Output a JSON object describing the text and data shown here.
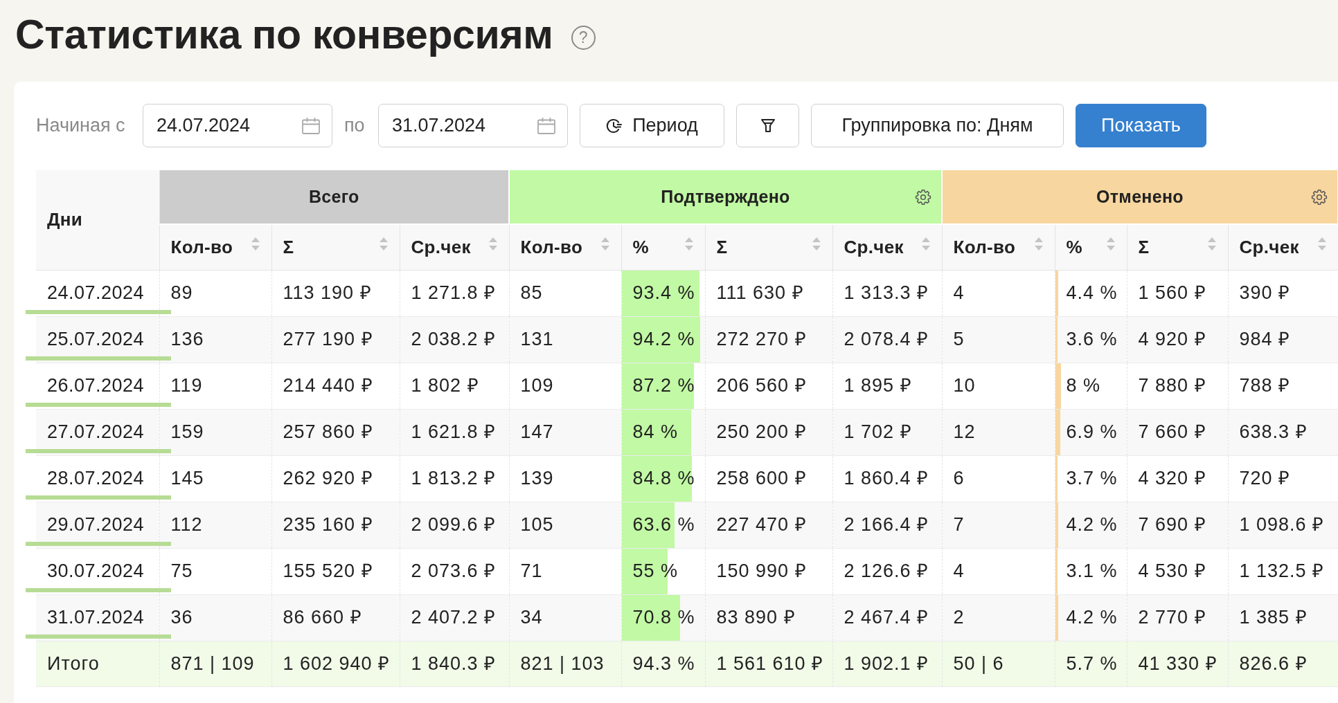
{
  "page": {
    "title": "Статистика по конверсиям",
    "help_icon": "?"
  },
  "toolbar": {
    "from_label": "Начиная с",
    "date_from": "24.07.2024",
    "to_label": "по",
    "date_to": "31.07.2024",
    "period_button": "Период",
    "grouping_button": "Группировка по: Дням",
    "show_button": "Показать"
  },
  "table": {
    "first_column": "Дни",
    "groups": [
      {
        "title": "Всего",
        "color": "#cccccc",
        "settings_icon": false,
        "columns": [
          {
            "label": "Кол-во",
            "kind": "text"
          },
          {
            "label": "Σ",
            "kind": "text"
          },
          {
            "label": "Ср.чек",
            "kind": "text"
          }
        ]
      },
      {
        "title": "Подтверждено",
        "color": "#c1f9a4",
        "settings_icon": true,
        "columns": [
          {
            "label": "Кол-во",
            "kind": "text"
          },
          {
            "label": "%",
            "kind": "bar"
          },
          {
            "label": "Σ",
            "kind": "text"
          },
          {
            "label": "Ср.чек",
            "kind": "text"
          }
        ]
      },
      {
        "title": "Отменено",
        "color": "#f8d6a0",
        "settings_icon": true,
        "columns": [
          {
            "label": "Кол-во",
            "kind": "text"
          },
          {
            "label": "%",
            "kind": "bar"
          },
          {
            "label": "Σ",
            "kind": "text"
          },
          {
            "label": "Ср.чек",
            "kind": "text"
          }
        ]
      }
    ],
    "rows": [
      {
        "day": "24.07.2024",
        "cells": [
          {
            "text": "89"
          },
          {
            "text": "113 190 ₽"
          },
          {
            "text": "1 271.8 ₽"
          },
          {
            "text": "85"
          },
          {
            "text": "93.4 %",
            "level": 0.934
          },
          {
            "text": "111 630 ₽"
          },
          {
            "text": "1 313.3 ₽"
          },
          {
            "text": "4"
          },
          {
            "text": "4.4 %",
            "level": 0.044
          },
          {
            "text": "1 560 ₽"
          },
          {
            "text": "390 ₽"
          }
        ]
      },
      {
        "day": "25.07.2024",
        "cells": [
          {
            "text": "136"
          },
          {
            "text": "277 190 ₽"
          },
          {
            "text": "2 038.2 ₽"
          },
          {
            "text": "131"
          },
          {
            "text": "94.2 %",
            "level": 0.942
          },
          {
            "text": "272 270 ₽"
          },
          {
            "text": "2 078.4 ₽"
          },
          {
            "text": "5"
          },
          {
            "text": "3.6 %",
            "level": 0.036
          },
          {
            "text": "4 920 ₽"
          },
          {
            "text": "984 ₽"
          }
        ]
      },
      {
        "day": "26.07.2024",
        "cells": [
          {
            "text": "119"
          },
          {
            "text": "214 440 ₽"
          },
          {
            "text": "1 802 ₽"
          },
          {
            "text": "109"
          },
          {
            "text": "87.2 %",
            "level": 0.872
          },
          {
            "text": "206 560 ₽"
          },
          {
            "text": "1 895 ₽"
          },
          {
            "text": "10"
          },
          {
            "text": "8 %",
            "level": 0.08
          },
          {
            "text": "7 880 ₽"
          },
          {
            "text": "788 ₽"
          }
        ]
      },
      {
        "day": "27.07.2024",
        "cells": [
          {
            "text": "159"
          },
          {
            "text": "257 860 ₽"
          },
          {
            "text": "1 621.8 ₽"
          },
          {
            "text": "147"
          },
          {
            "text": "84 %",
            "level": 0.84
          },
          {
            "text": "250 200 ₽"
          },
          {
            "text": "1 702 ₽"
          },
          {
            "text": "12"
          },
          {
            "text": "6.9 %",
            "level": 0.069
          },
          {
            "text": "7 660 ₽"
          },
          {
            "text": "638.3 ₽"
          }
        ]
      },
      {
        "day": "28.07.2024",
        "cells": [
          {
            "text": "145"
          },
          {
            "text": "262 920 ₽"
          },
          {
            "text": "1 813.2 ₽"
          },
          {
            "text": "139"
          },
          {
            "text": "84.8 %",
            "level": 0.848
          },
          {
            "text": "258 600 ₽"
          },
          {
            "text": "1 860.4 ₽"
          },
          {
            "text": "6"
          },
          {
            "text": "3.7 %",
            "level": 0.037
          },
          {
            "text": "4 320 ₽"
          },
          {
            "text": "720 ₽"
          }
        ]
      },
      {
        "day": "29.07.2024",
        "cells": [
          {
            "text": "112"
          },
          {
            "text": "235 160 ₽"
          },
          {
            "text": "2 099.6 ₽"
          },
          {
            "text": "105"
          },
          {
            "text": "63.6 %",
            "level": 0.636
          },
          {
            "text": "227 470 ₽"
          },
          {
            "text": "2 166.4 ₽"
          },
          {
            "text": "7"
          },
          {
            "text": "4.2 %",
            "level": 0.042
          },
          {
            "text": "7 690 ₽"
          },
          {
            "text": "1 098.6 ₽"
          }
        ]
      },
      {
        "day": "30.07.2024",
        "cells": [
          {
            "text": "75"
          },
          {
            "text": "155 520 ₽"
          },
          {
            "text": "2 073.6 ₽"
          },
          {
            "text": "71"
          },
          {
            "text": "55 %",
            "level": 0.55
          },
          {
            "text": "150 990 ₽"
          },
          {
            "text": "2 126.6 ₽"
          },
          {
            "text": "4"
          },
          {
            "text": "3.1 %",
            "level": 0.031
          },
          {
            "text": "4 530 ₽"
          },
          {
            "text": "1 132.5 ₽"
          }
        ]
      },
      {
        "day": "31.07.2024",
        "cells": [
          {
            "text": "36"
          },
          {
            "text": "86 660 ₽"
          },
          {
            "text": "2 407.2 ₽"
          },
          {
            "text": "34"
          },
          {
            "text": "70.8 %",
            "level": 0.708
          },
          {
            "text": "83 890 ₽"
          },
          {
            "text": "2 467.4 ₽"
          },
          {
            "text": "2"
          },
          {
            "text": "4.2 %",
            "level": 0.042
          },
          {
            "text": "2 770 ₽"
          },
          {
            "text": "1 385 ₽"
          }
        ]
      }
    ],
    "totals": {
      "label": "Итого",
      "cells": [
        "871 | 109",
        "1 602 940 ₽",
        "1 840.3 ₽",
        "821 | 103",
        "94.3 %",
        "1 561 610 ₽",
        "1 902.1 ₽",
        "50 | 6",
        "5.7 %",
        "41 330 ₽",
        "826.6 ₽"
      ]
    }
  }
}
